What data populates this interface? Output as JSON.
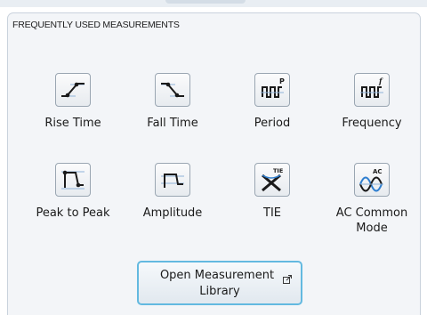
{
  "panel": {
    "title": "FREQUENTLY USED MEASUREMENTS"
  },
  "measurements": [
    {
      "label": "Rise Time",
      "icon": "rise-time-icon"
    },
    {
      "label": "Fall Time",
      "icon": "fall-time-icon"
    },
    {
      "label": "Period",
      "icon": "period-icon"
    },
    {
      "label": "Frequency",
      "icon": "frequency-icon"
    },
    {
      "label": "Peak to Peak",
      "icon": "peak-to-peak-icon"
    },
    {
      "label": "Amplitude",
      "icon": "amplitude-icon"
    },
    {
      "label": "TIE",
      "icon": "tie-icon"
    },
    {
      "label": "AC Common",
      "label2": "Mode",
      "icon": "ac-common-mode-icon"
    }
  ],
  "icon_text": {
    "period": "P",
    "frequency": "f",
    "tie": "TIE",
    "ac": "AC"
  },
  "library_button": {
    "line1": "Open Measurement",
    "line2": "Library",
    "icon": "external-link-icon"
  },
  "colors": {
    "accent_border": "#63b9e0",
    "panel_bg": "#f3f5f8",
    "icon_blue": "#2f7fd0",
    "icon_dark": "#1a1a1a"
  }
}
